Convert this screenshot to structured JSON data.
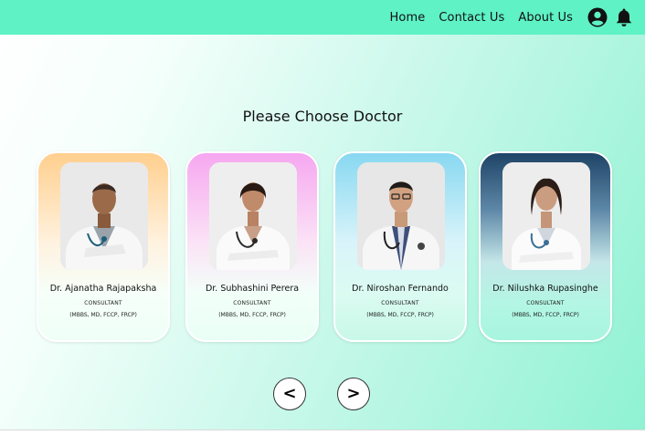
{
  "nav": {
    "links": [
      "Home",
      "Contact Us",
      "About Us"
    ],
    "icons": [
      "user-account-icon",
      "bell-icon"
    ]
  },
  "main": {
    "title": "Please Choose Doctor"
  },
  "doctors": [
    {
      "name": "Dr. Ajanatha Rajapaksha",
      "role": "CONSULTANT",
      "qualifications": "(MBBS, MD, FCCP, FRCP)"
    },
    {
      "name": "Dr. Subhashini Perera",
      "role": "CONSULTANT",
      "qualifications": "(MBBS, MD, FCCP, FRCP)"
    },
    {
      "name": "Dr. Niroshan Fernando",
      "role": "CONSULTANT",
      "qualifications": "(MBBS, MD, FCCP, FRCP)"
    },
    {
      "name": "Dr. Nilushka Rupasinghe",
      "role": "CONSULTANT",
      "qualifications": "(MBBS, MD, FCCP, FRCP)"
    }
  ],
  "pagination": {
    "prev_label": "<",
    "next_label": ">"
  },
  "colors": {
    "navbar": "#5ef2c4",
    "card_1_accent": "#ffcf8e",
    "card_2_accent": "#f6a7f0",
    "card_3_accent": "#88d8f1",
    "card_4_accent": "#1e4366"
  }
}
